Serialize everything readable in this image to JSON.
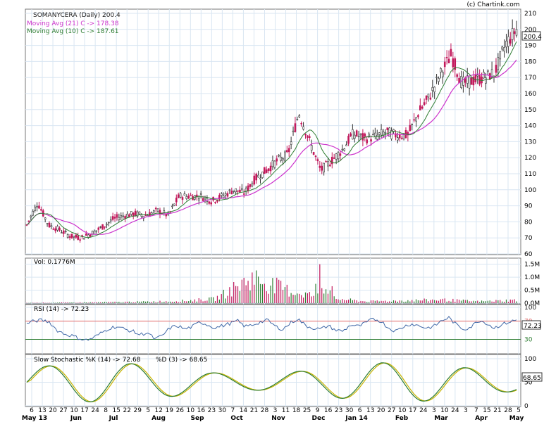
{
  "header": {
    "copyright": "(c) Chartink.com",
    "title": "SOMANYCERA (Daily) 200.4",
    "ma21": "Moving Avg (21) C -> 178.38",
    "ma10": "Moving Avg (10) C -> 187.61",
    "last_price": "200.4"
  },
  "colors": {
    "up": "#333333",
    "down": "#c2185b",
    "ma21": "#cc33cc",
    "ma10": "#2e7d32",
    "grid": "#d9e6f2",
    "rsi": "#4169a8",
    "rsi_line": "#e06666",
    "stoch_k": "#2e7d32",
    "stoch_d": "#c8b400"
  },
  "volume_panel": {
    "label": "Vol: 0.1776M",
    "ticks": [
      "1.5M",
      "1.0M",
      "0.5M",
      "0.0M"
    ]
  },
  "rsi_panel": {
    "label": "RSI (14) -> 72.23",
    "value": "72.23",
    "ticks": [
      "100",
      "70",
      "30"
    ]
  },
  "stoch_panel": {
    "label_k": "Slow Stochastic %K (14) -> 72.68",
    "label_d": "%D (3) -> 68.65",
    "value": "68.65",
    "ticks": [
      "100",
      "50",
      "0"
    ]
  },
  "x_axis": {
    "day_ticks": [
      "6",
      "13",
      "20",
      "27",
      "10",
      "17",
      "24",
      "8",
      "15",
      "22",
      "29",
      "5",
      "12",
      "19",
      "26",
      "10",
      "16",
      "23",
      "30",
      "7",
      "14",
      "21",
      "28",
      "3",
      "11",
      "18",
      "25",
      "9",
      "16",
      "23",
      "30",
      "6",
      "13",
      "20",
      "27",
      "10",
      "17",
      "24",
      "3",
      "10",
      "24",
      "3",
      "7",
      "15",
      "21",
      "28",
      "5"
    ],
    "month_labels": [
      "May 13",
      "Jun",
      "Jul",
      "Aug",
      "Sep",
      "Oct",
      "Nov",
      "Dec",
      "Jan 14",
      "Feb",
      "Mar",
      "Apr",
      "May"
    ]
  },
  "chart_data": [
    {
      "type": "candlestick",
      "title": "SOMANYCERA (Daily) 200.4",
      "ylim": [
        60,
        210
      ],
      "yticks": [
        60,
        70,
        80,
        90,
        100,
        110,
        120,
        130,
        140,
        150,
        160,
        170,
        180,
        190,
        200,
        210
      ],
      "x": [
        "May 13",
        "Jun",
        "Jul",
        "Aug",
        "Sep",
        "Oct",
        "Nov",
        "Dec",
        "Jan 14",
        "Feb",
        "Mar",
        "Apr",
        "May"
      ],
      "close_trend": [
        78,
        92,
        78,
        75,
        71,
        70,
        73,
        77,
        82,
        84,
        85,
        84,
        87,
        84,
        96,
        96,
        96,
        93,
        96,
        100,
        98,
        107,
        112,
        118,
        122,
        148,
        130,
        112,
        118,
        125,
        135,
        132,
        133,
        136,
        134,
        134,
        148,
        158,
        172,
        184,
        166,
        168,
        170,
        173,
        191,
        200
      ],
      "series": [
        {
          "name": "Moving Avg (21) C",
          "last": 178.38
        },
        {
          "name": "Moving Avg (10) C",
          "last": 187.61
        }
      ]
    },
    {
      "type": "bar",
      "title": "Vol: 0.1776M",
      "ylim": [
        0,
        1.6
      ],
      "peaks": [
        0.02,
        0.03,
        0.05,
        0.08,
        0.12,
        0.25,
        1.5,
        0.7,
        0.3,
        0.1,
        0.15,
        0.2,
        0.1,
        0.18
      ]
    },
    {
      "type": "line",
      "title": "RSI (14) -> 72.23",
      "ylim": [
        0,
        100
      ],
      "values": [
        65,
        70,
        72,
        68,
        50,
        42,
        38,
        32,
        28,
        35,
        45,
        55,
        58,
        52,
        48,
        40,
        45,
        30,
        38,
        55,
        60,
        52,
        58,
        68,
        62,
        55,
        60,
        65,
        70,
        58,
        62,
        68,
        72,
        58,
        52,
        66,
        75,
        60,
        55,
        52,
        60,
        50,
        48,
        62,
        58,
        66,
        75,
        70,
        55,
        48,
        58,
        64,
        60,
        55,
        58,
        70,
        78,
        62,
        52,
        58,
        72,
        66,
        55,
        62,
        68,
        72
      ]
    },
    {
      "type": "line",
      "title": "Slow Stochastic",
      "ylim": [
        0,
        100
      ],
      "series": [
        {
          "name": "%K (14)",
          "last": 72.68
        },
        {
          "name": "%D (3)",
          "last": 68.65
        }
      ]
    }
  ]
}
